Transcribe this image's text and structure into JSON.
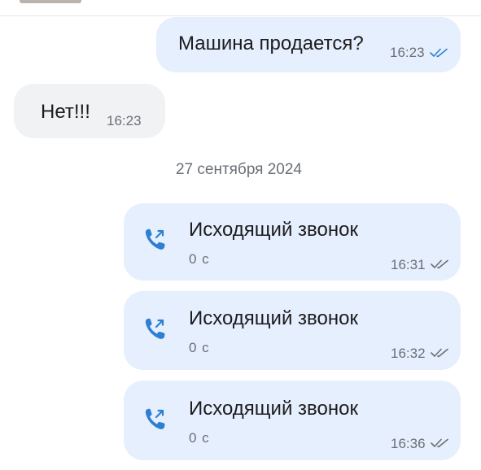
{
  "messages": [
    {
      "direction": "outgoing",
      "text": "Машина продается?",
      "time": "16:23",
      "read": true
    },
    {
      "direction": "incoming",
      "text": "Нет!!!",
      "time": "16:23"
    }
  ],
  "date_separator": "27 сентября 2024",
  "calls": [
    {
      "title": "Исходящий звонок",
      "duration": "0 с",
      "time": "16:31",
      "read": true
    },
    {
      "title": "Исходящий звонок",
      "duration": "0 с",
      "time": "16:32",
      "read": true
    },
    {
      "title": "Исходящий звонок",
      "duration": "0 с",
      "time": "16:36",
      "read": true
    }
  ],
  "colors": {
    "outgoing_bubble": "#e6effd",
    "incoming_bubble": "#f1f2f4",
    "accent": "#2d7fd3",
    "meta_text": "#6b6f76"
  },
  "icons": {
    "call": "outgoing-call-icon",
    "read_receipt": "double-check-icon"
  }
}
